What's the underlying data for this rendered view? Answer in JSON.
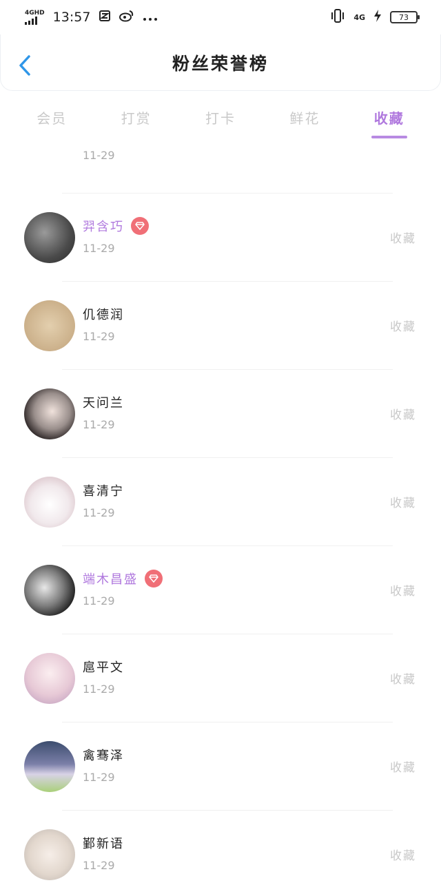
{
  "status_bar": {
    "network": "4GHD",
    "time": "13:57",
    "net_right": "4G",
    "battery": "73"
  },
  "header": {
    "title": "粉丝荣誉榜"
  },
  "tabs": [
    {
      "label": "会员",
      "active": false
    },
    {
      "label": "打赏",
      "active": false
    },
    {
      "label": "打卡",
      "active": false
    },
    {
      "label": "鲜花",
      "active": false
    },
    {
      "label": "收藏",
      "active": true
    }
  ],
  "partial_row": {
    "date": "11-29"
  },
  "fans": [
    {
      "name": "羿含巧",
      "date": "11-29",
      "vip": true,
      "action": "收藏"
    },
    {
      "name": "仉德润",
      "date": "11-29",
      "vip": false,
      "action": "收藏"
    },
    {
      "name": "天问兰",
      "date": "11-29",
      "vip": false,
      "action": "收藏"
    },
    {
      "name": "喜清宁",
      "date": "11-29",
      "vip": false,
      "action": "收藏"
    },
    {
      "name": "端木昌盛",
      "date": "11-29",
      "vip": true,
      "action": "收藏"
    },
    {
      "name": "扈平文",
      "date": "11-29",
      "vip": false,
      "action": "收藏"
    },
    {
      "name": "禽骞泽",
      "date": "11-29",
      "vip": false,
      "action": "收藏"
    },
    {
      "name": "鄞新语",
      "date": "11-29",
      "vip": false,
      "action": "收藏"
    }
  ],
  "colors": {
    "accent": "#b079de",
    "badge": "#f06f77",
    "back": "#2f96e8"
  }
}
